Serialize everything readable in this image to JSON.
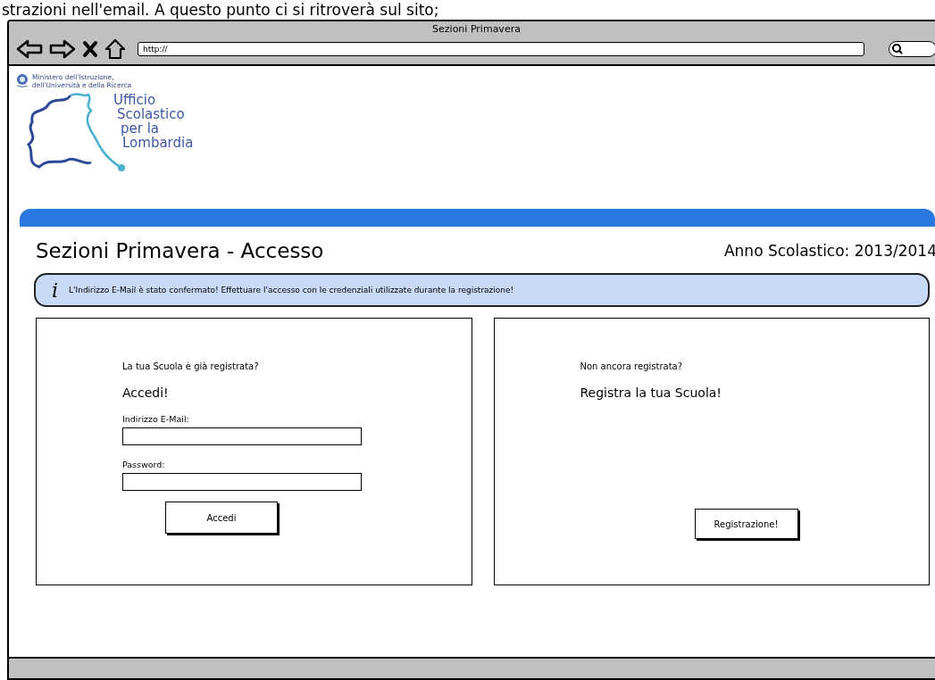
{
  "caption": "strazioni nell'email. A questo punto ci si ritroverà sul sito;",
  "window": {
    "title": "Sezioni Primavera",
    "url": "http://"
  },
  "logo": {
    "ministry": [
      "Ministero dell'Istruzione,",
      "dell'Università e della Ricerca"
    ],
    "office": [
      "Ufficio",
      "Scolastico",
      "per la",
      "Lombardia"
    ]
  },
  "heading": "Sezioni Primavera - Accesso",
  "school_year": "Anno Scolastico: 2013/2014",
  "info": {
    "icon": "i",
    "message": "L'Indirizzo E-Mail è stato confermato! Effettuare l'accesso con le credenziali utilizzate durante la registrazione!"
  },
  "login": {
    "question": "La tua Scuola è già registrata?",
    "title": "Accedi!",
    "fields": [
      {
        "label": "Indirizzo E-Mail:"
      },
      {
        "label": "Password:"
      }
    ],
    "button": "Accedi"
  },
  "register": {
    "question": "Non ancora registrata?",
    "title": "Registra la tua Scuola!",
    "button": "Registrazione!"
  }
}
